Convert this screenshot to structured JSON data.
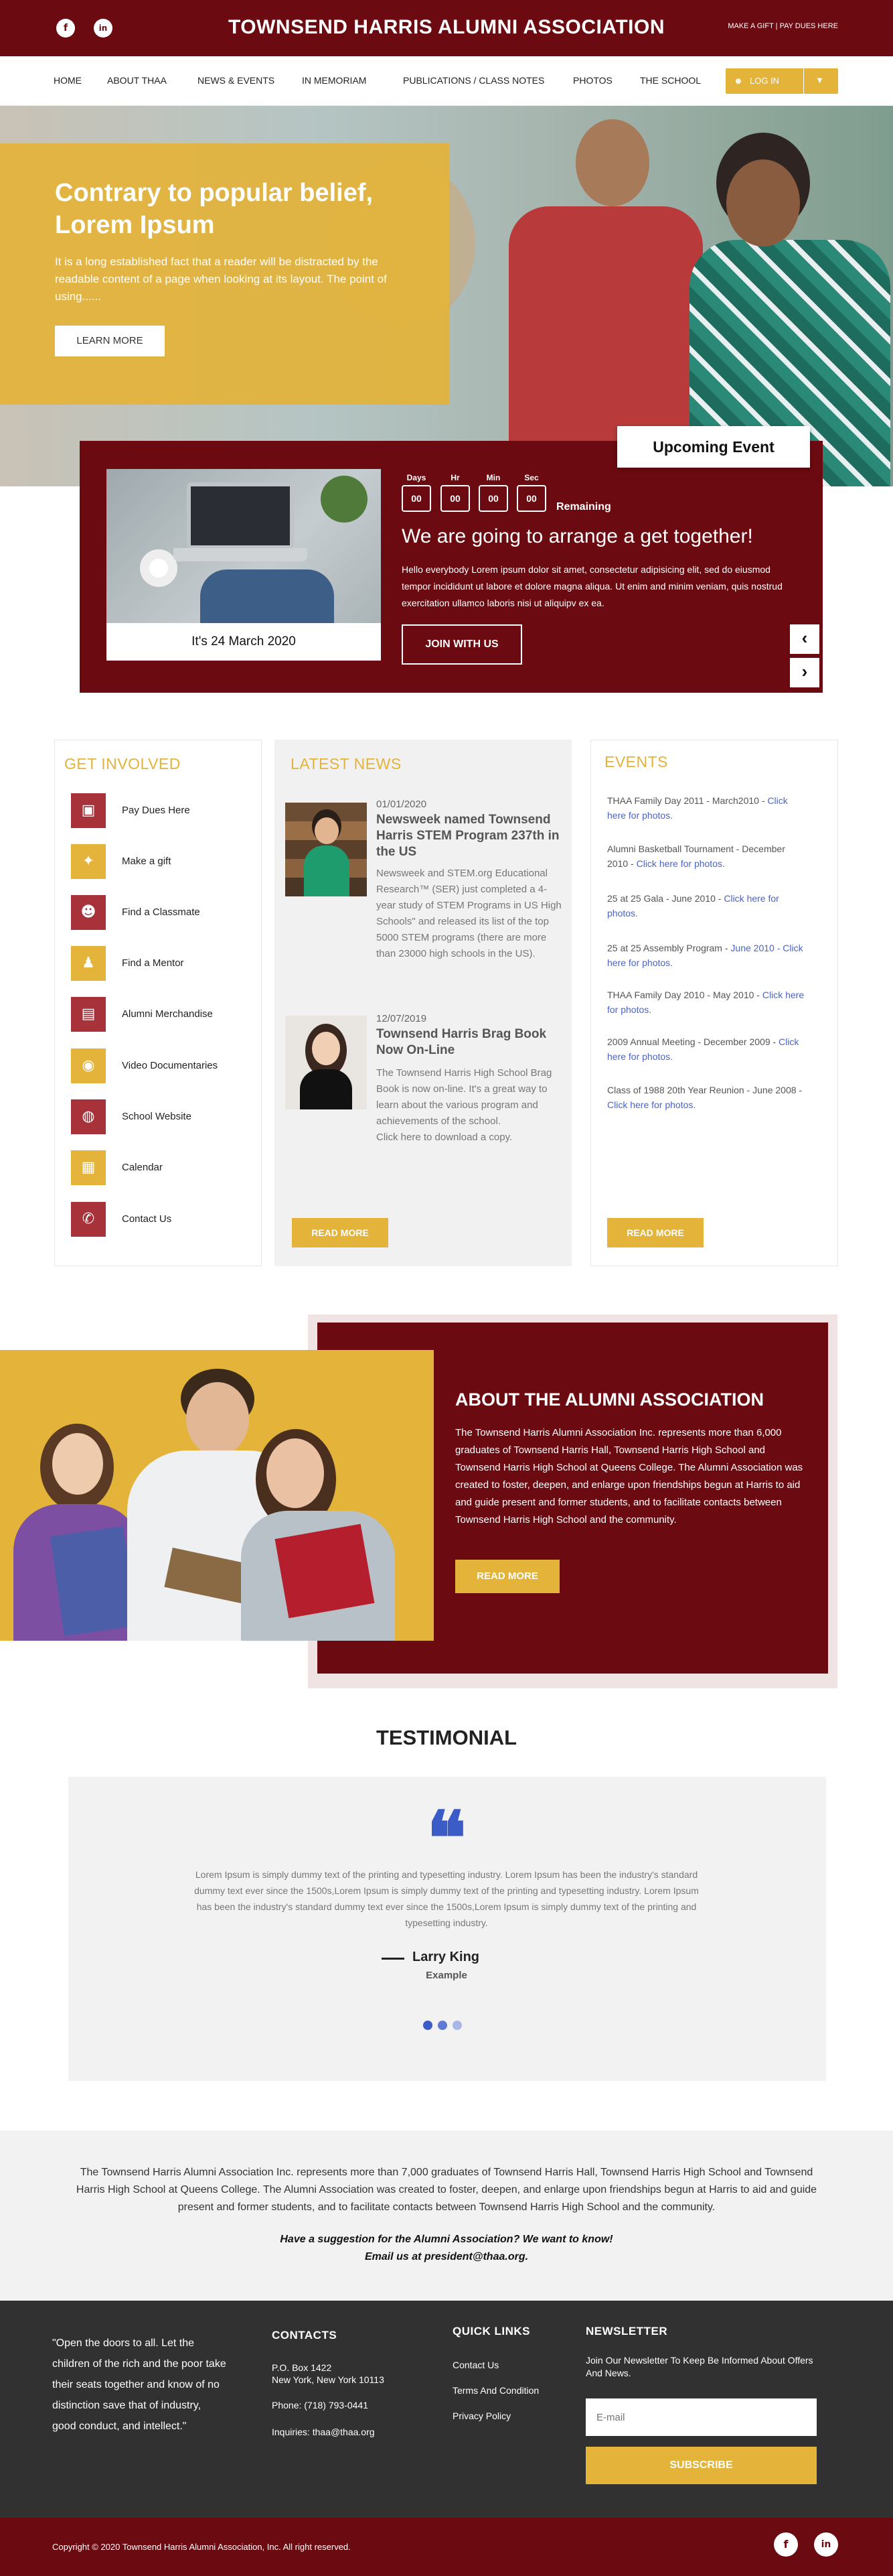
{
  "header": {
    "title": "TOWNSEND HARRIS ALUMNI ASSOCIATION",
    "top_links": "MAKE A GIFT  |  PAY DUES HERE",
    "social": [
      "f",
      "in"
    ]
  },
  "nav": {
    "items": [
      "HOME",
      "ABOUT THAA",
      "NEWS & EVENTS",
      "IN MEMORIAM",
      "PUBLICATIONS / CLASS NOTES",
      "PHOTOS",
      "THE SCHOOL"
    ],
    "login_label": "LOG IN"
  },
  "hero": {
    "title": "Contrary to popular belief, Lorem Ipsum",
    "text": "It is a long established fact that a reader will be distracted by the readable content of a page when looking at its layout. The point of using......",
    "button": "LEARN MORE"
  },
  "event": {
    "tab": "Upcoming Event",
    "date_label": "It's 24 March 2020",
    "countdown": [
      {
        "label": "Days",
        "value": "00"
      },
      {
        "label": "Hr",
        "value": "00"
      },
      {
        "label": "Min",
        "value": "00"
      },
      {
        "label": "Sec",
        "value": "00"
      }
    ],
    "remaining": "Remaining",
    "heading": "We are going to arrange a get together!",
    "description": "Hello everybody Lorem ipsum dolor sit amet, consectetur adipisicing elit, sed do eiusmod tempor incididunt ut labore et dolore magna aliqua. Ut enim and minim veniam, quis nostrud exercitation ullamco laboris nisi ut aliquipv ex ea.",
    "button": "JOIN WITH US",
    "prev": "‹",
    "next": "›"
  },
  "get_involved": {
    "title": "GET INVOLVED",
    "items": [
      {
        "label": "Pay Dues Here",
        "icon": "wallet-icon",
        "color": "#a8323a"
      },
      {
        "label": "Make a gift",
        "icon": "gift-icon",
        "color": "#e3b33a"
      },
      {
        "label": "Find a Classmate",
        "icon": "search-person-icon",
        "color": "#a8323a"
      },
      {
        "label": "Find a Mentor",
        "icon": "mentor-icon",
        "color": "#e3b33a"
      },
      {
        "label": "Alumni Merchandise",
        "icon": "shirt-icon",
        "color": "#a8323a"
      },
      {
        "label": "Video Documentaries",
        "icon": "location-icon",
        "color": "#e3b33a"
      },
      {
        "label": "School Website",
        "icon": "globe-icon",
        "color": "#a8323a"
      },
      {
        "label": "Calendar",
        "icon": "calendar-icon",
        "color": "#e3b33a"
      },
      {
        "label": "Contact Us",
        "icon": "phone-icon",
        "color": "#a8323a"
      }
    ]
  },
  "latest_news": {
    "title": "LATEST NEWS",
    "items": [
      {
        "date": "01/01/2020",
        "title": "Newsweek named Townsend Harris STEM Program 237th in the US",
        "text": "Newsweek and STEM.org Educational Research™ (SER) just completed a 4-year study of STEM Programs in US High Schools\" and released its list of the top 5000 STEM programs (there are more than 23000 high schools in the US)."
      },
      {
        "date": "12/07/2019",
        "title": "Townsend Harris Brag Book Now On-Line",
        "text": "The Townsend Harris High School Brag Book is now on-line. It's a great way to learn about the various program and achievements of the school.\nClick here to download a copy."
      }
    ],
    "button": "READ MORE"
  },
  "events": {
    "title": "EVENTS",
    "items": [
      {
        "text": "THAA Family Day 2011 - March2010 - ",
        "link": "Click here for photos."
      },
      {
        "text": "Alumni Basketball Tournament - December 2010 - ",
        "link": "Click here for photos."
      },
      {
        "text": "25 at 25 Gala - June 2010 - ",
        "link": "Click here for photos."
      },
      {
        "text": "25 at 25 Assembly Program - ",
        "link": "June 2010 - Click here for photos."
      },
      {
        "text": "THAA Family Day 2010 - May 2010 - ",
        "link": "Click here for photos."
      },
      {
        "text": "2009 Annual Meeting - December 2009 - ",
        "link": "Click here for photos."
      },
      {
        "text": "Class of 1988 20th Year Reunion - June 2008 - ",
        "link": "Click here for photos."
      }
    ],
    "button": "READ MORE"
  },
  "about": {
    "title": "ABOUT THE ALUMNI ASSOCIATION",
    "text": "The Townsend Harris Alumni Association Inc. represents more than 6,000 graduates of Townsend Harris Hall, Townsend Harris High School and Townsend Harris High School at Queens College. The Alumni Association was created to foster, deepen, and enlarge upon friendships begun at Harris to aid and guide present and former students, and to facilitate contacts between Townsend Harris High School and the community.",
    "button": "READ MORE"
  },
  "testimonial": {
    "title": "TESTIMONIAL",
    "quote_mark": "❝",
    "text": "Lorem Ipsum is simply dummy text of the printing and typesetting industry. Lorem Ipsum has been the industry's standard dummy text ever since the 1500s,Lorem Ipsum is simply dummy text of the printing and typesetting industry. Lorem Ipsum has been the industry's standard dummy text ever since the 1500s,Lorem Ipsum is simply dummy text of the printing and typesetting industry.",
    "name": "Larry King",
    "role": "Example",
    "dots": [
      {
        "color": "#3b5bc6"
      },
      {
        "color": "#5f7ad2"
      },
      {
        "color": "#a9b7e8"
      }
    ]
  },
  "info": {
    "text": "The Townsend Harris Alumni Association Inc. represents more than 7,000 graduates of Townsend Harris Hall, Townsend Harris High School and Townsend Harris High School at Queens College. The Alumni Association was created to foster, deepen, and enlarge upon friendships begun at Harris to aid and guide present and former students, and to facilitate contacts between Townsend Harris High School and the community.",
    "suggestion": "Have a suggestion for the Alumni Association? We want to know!",
    "email_line": "Email us at president@thaa.org."
  },
  "footer": {
    "quote": "\"Open the doors to all. Let the children of the rich and the poor take their seats together and know of no distinction save that of industry, good conduct, and intellect.\"",
    "contacts_title": "CONTACTS",
    "address1": "P.O. Box 1422",
    "address2": "New York, New York 10113",
    "phone": "Phone: (718) 793-0441",
    "inquiries": "Inquiries: thaa@thaa.org",
    "quick_links_title": "QUICK LINKS",
    "quick_links": [
      "Contact Us",
      "Terms And Condition",
      "Privacy Policy"
    ],
    "newsletter_title": "NEWSLETTER",
    "newsletter_text": "Join Our Newsletter To Keep Be Informed About Offers And News.",
    "email_placeholder": "E-mail",
    "subscribe": "SUBSCRIBE",
    "copyright": "Copyright © 2020 Townsend Harris Alumni Association, Inc. All right reserved."
  },
  "colors": {
    "maroon": "#6b0a10",
    "gold": "#e3b33a",
    "link_blue": "#4a63c9"
  }
}
